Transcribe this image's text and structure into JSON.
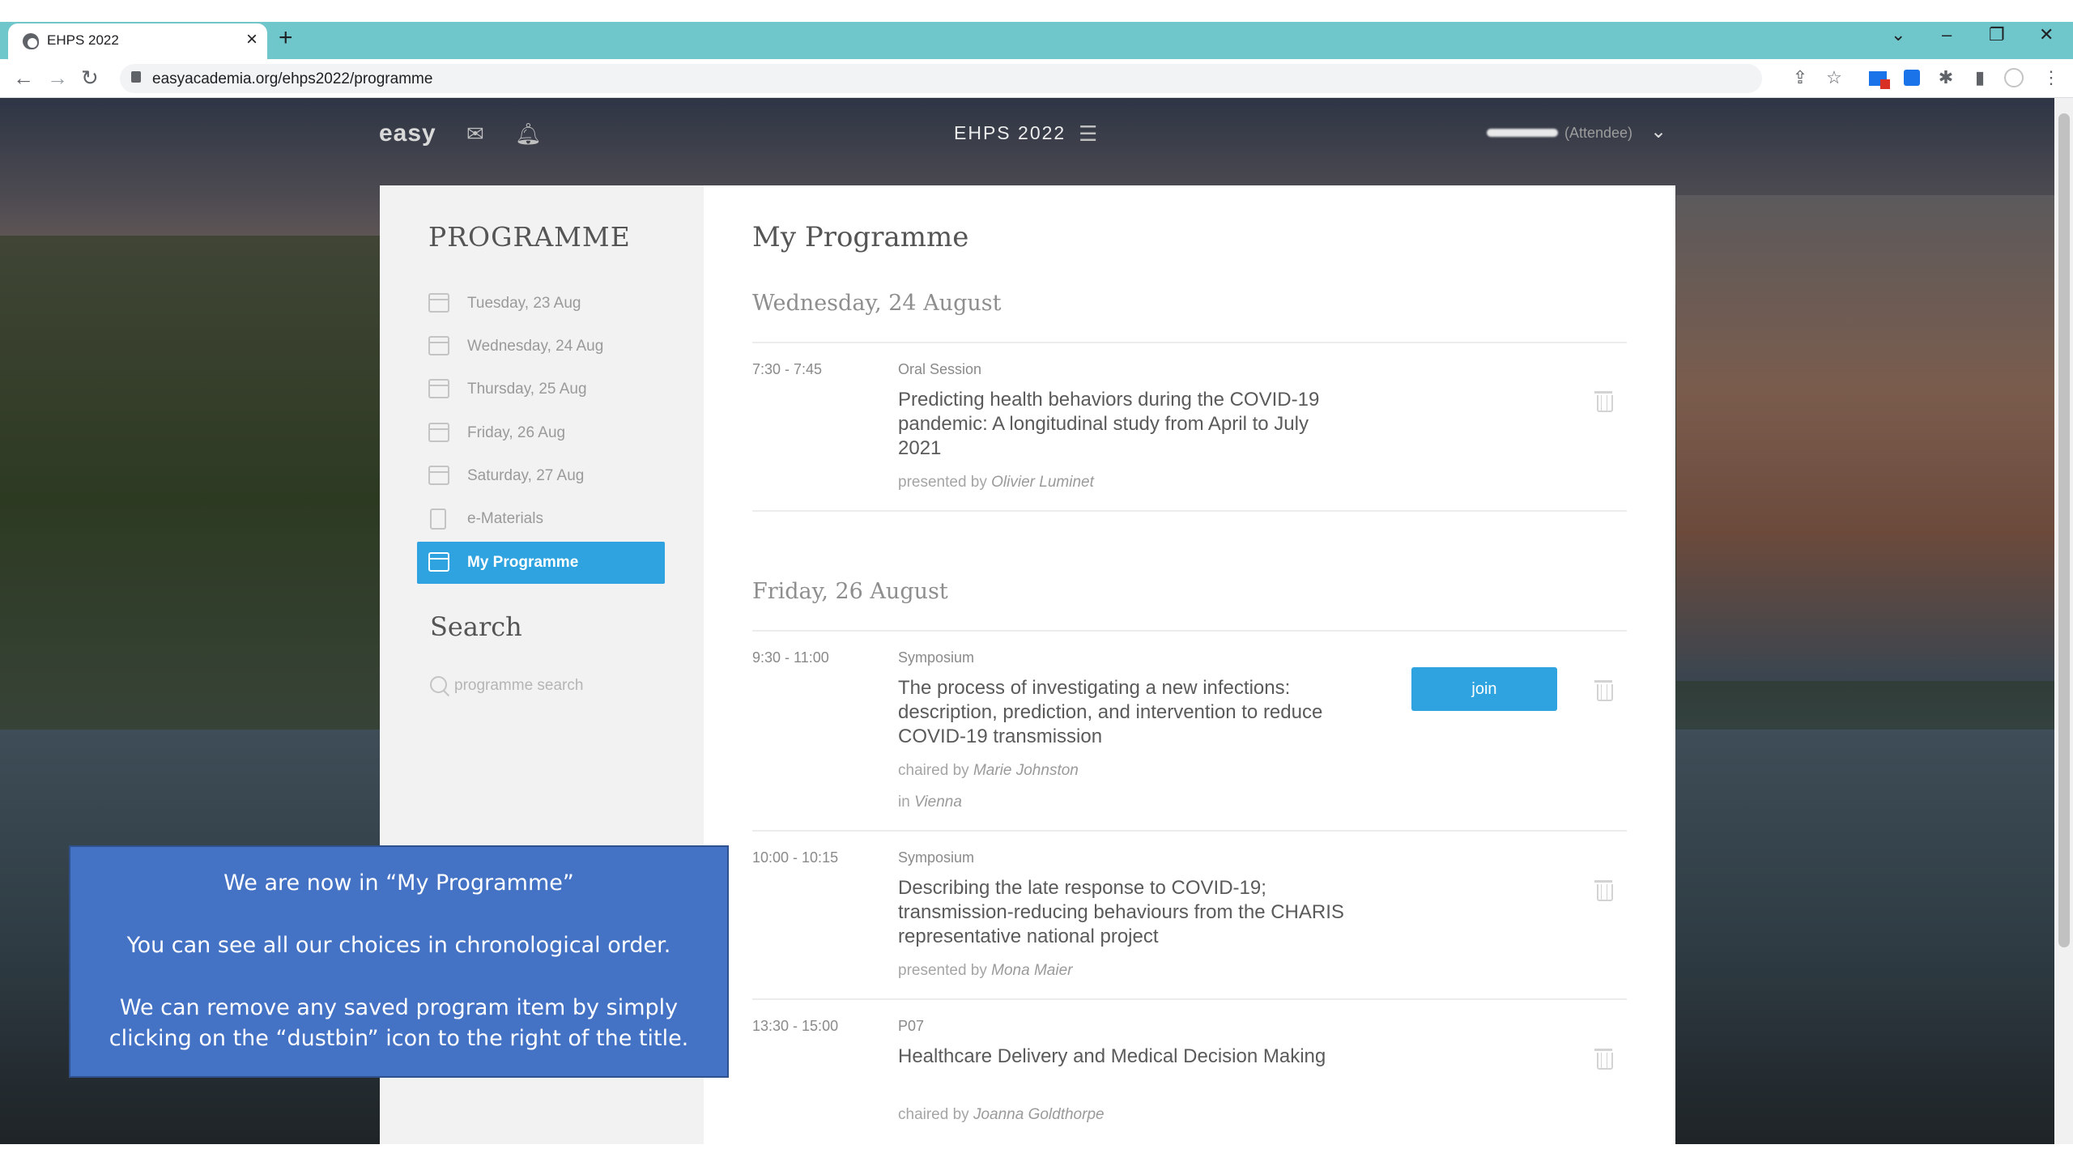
{
  "browser": {
    "tab_title": "EHPS 2022",
    "tab_close": "×",
    "new_tab": "+",
    "url": "easyacademia.org/ehps2022/programme",
    "window_controls": {
      "tab_search": "⌄",
      "minimize": "–",
      "restore": "❐",
      "close": "✕"
    },
    "nav": {
      "back": "←",
      "forward": "→",
      "reload": "↻"
    }
  },
  "site": {
    "brand": "easy",
    "conference": "EHPS 2022",
    "user_role": "(Attendee)"
  },
  "sidebar": {
    "heading": "PROGRAMME",
    "items": [
      {
        "label": "Tuesday, 23 Aug",
        "icon": "calendar-icon"
      },
      {
        "label": "Wednesday, 24 Aug",
        "icon": "calendar-icon"
      },
      {
        "label": "Thursday, 25 Aug",
        "icon": "calendar-icon"
      },
      {
        "label": "Friday, 26 Aug",
        "icon": "calendar-icon"
      },
      {
        "label": "Saturday, 27 Aug",
        "icon": "calendar-icon"
      },
      {
        "label": "e-Materials",
        "icon": "document-icon"
      },
      {
        "label": "My Programme",
        "icon": "user-card-icon",
        "active": true
      }
    ],
    "search_heading": "Search",
    "search_placeholder": "programme search"
  },
  "main": {
    "title": "My Programme",
    "days": [
      {
        "heading": "Wednesday, 24 August",
        "events": [
          {
            "time": "7:30 - 7:45",
            "type": "Oral Session",
            "title": "Predicting health behaviors during the COVID-19 pandemic: A longitudinal study from April to July 2021",
            "meta_prefix": "presented by",
            "meta_name": "Olivier Luminet"
          }
        ]
      },
      {
        "heading": "Friday, 26 August",
        "events": [
          {
            "time": "9:30 - 11:00",
            "type": "Symposium",
            "title": "The process of investigating a new infections: description, prediction, and intervention to reduce COVID-19 transmission",
            "meta_prefix": "chaired by",
            "meta_name": "Marie Johnston",
            "location_prefix": "in",
            "location": "Vienna",
            "join_label": "join"
          },
          {
            "time": "10:00 - 10:15",
            "type": "Symposium",
            "title": "Describing the late response to COVID-19; transmission-reducing behaviours from the CHARIS representative national project",
            "meta_prefix": "presented by",
            "meta_name": "Mona Maier"
          },
          {
            "time": "13:30 - 15:00",
            "type": "P07",
            "title": "Healthcare Delivery and Medical Decision Making",
            "meta_prefix": "chaired by",
            "meta_name": "Joanna Goldthorpe"
          }
        ]
      }
    ]
  },
  "callout": {
    "line1": "We are now in “My Programme”",
    "line2": "You can see all our choices in chronological order.",
    "line3": "We can remove any saved program item by simply clicking on the “dustbin” icon to the right of the title."
  },
  "colors": {
    "accent": "#2ea3df",
    "tabstrip": "#6fc7cb",
    "callout": "#4472c4"
  }
}
